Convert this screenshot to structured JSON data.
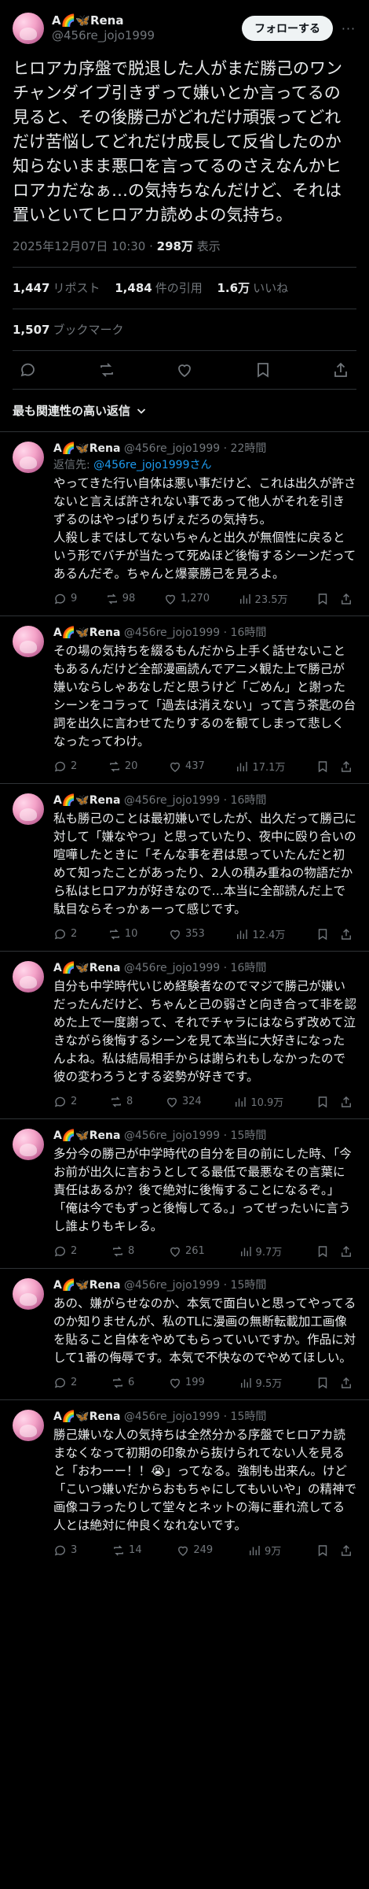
{
  "post": {
    "display_name": "A🌈🦋Rena",
    "handle": "@456re_jojo1999",
    "follow_label": "フォローする",
    "more_label": "···",
    "text": "ヒロアカ序盤で脱退した人がまだ勝己のワンチャンダイブ引きずって嫌いとか言ってるの見ると、その後勝己がどれだけ頑張ってどれだけ苦悩してどれだけ成長して反省したのか知らないまま悪口を言ってるのさえなんかヒロアカだなぁ…の気持ちなんだけど、それは置いといてヒロアカ読めよの気持ち。",
    "timestamp": "2025年12月07日 10:30 · ",
    "views_count": "298万",
    "views_label": " 表示",
    "stats": {
      "reposts_count": "1,447",
      "reposts_label": "リポスト",
      "quotes_count": "1,484",
      "quotes_label": "件の引用",
      "likes_count": "1.6万",
      "likes_label": "いいね",
      "bookmarks_count": "1,507",
      "bookmarks_label": "ブックマーク"
    }
  },
  "sort_label": "最も関連性の高い返信",
  "replies": [
    {
      "name": "A🌈🦋Rena",
      "handle": "@456re_jojo1999",
      "time": "22時間",
      "reply_to_label": "返信先:",
      "reply_to_mention": "@456re_jojo1999さん",
      "text": "やってきた行い自体は悪い事だけど、これは出久が許さないと言えば許されない事であって他人がそれを引きずるのはやっぱりちげぇだろの気持ち。\n人殺しまではしてないちゃんと出久が無個性に戻るという形でバチが当たって死ぬほど後悔するシーンだってあるんだぞ。ちゃんと爆豪勝己を見ろよ。",
      "replies": "9",
      "reposts": "98",
      "likes": "1,270",
      "views": "23.5万"
    },
    {
      "name": "A🌈🦋Rena",
      "handle": "@456re_jojo1999",
      "time": "16時間",
      "text": "その場の気持ちを綴るもんだから上手く話せないこともあるんだけど全部漫画読んでアニメ観た上で勝己が嫌いならしゃあなしだと思うけど「ごめん」と謝ったシーンをコラって「過去は消えない」って言う茶匙の台詞を出久に言わせてたりするのを観てしまって悲しくなったってわけ。",
      "replies": "2",
      "reposts": "20",
      "likes": "437",
      "views": "17.1万"
    },
    {
      "name": "A🌈🦋Rena",
      "handle": "@456re_jojo1999",
      "time": "16時間",
      "text": "私も勝己のことは最初嫌いでしたが、出久だって勝己に対して「嫌なやつ」と思っていたり、夜中に殴り合いの喧嘩したときに「そんな事を君は思っていたんだと初めて知ったことがあったり、2人の積み重ねの物語だから私はヒロアカが好きなので…本当に全部読んだ上で駄目ならそっかぁーって感じです。",
      "replies": "2",
      "reposts": "10",
      "likes": "353",
      "views": "12.4万"
    },
    {
      "name": "A🌈🦋Rena",
      "handle": "@456re_jojo1999",
      "time": "16時間",
      "text": "自分も中学時代いじめ経験者なのでマジで勝己が嫌いだったんだけど、ちゃんと己の弱さと向き合って非を認めた上で一度謝って、それでチャラにはならず改めて泣きながら後悔するシーンを見て本当に大好きになったんよね。私は結局相手からは謝られもしなかったので彼の変わろうとする姿勢が好きです。",
      "replies": "2",
      "reposts": "8",
      "likes": "324",
      "views": "10.9万"
    },
    {
      "name": "A🌈🦋Rena",
      "handle": "@456re_jojo1999",
      "time": "15時間",
      "text": "多分今の勝己が中学時代の自分を目の前にした時、「今お前が出久に言おうとしてる最低で最悪なその言葉に責任はあるか？後で絶対に後悔することになるぞ。」\n「俺は今でもずっと後悔してる。」ってぜったいに言うし誰よりもキレる。",
      "replies": "2",
      "reposts": "8",
      "likes": "261",
      "views": "9.7万"
    },
    {
      "name": "A🌈🦋Rena",
      "handle": "@456re_jojo1999",
      "time": "15時間",
      "text": "あの、嫌がらせなのか、本気で面白いと思ってやってるのか知りませんが、私のTLに漫画の無断転載加工画像を貼ること自体をやめてもらっていいですか。作品に対して1番の侮辱です。本気で不快なのでやめてほしい。",
      "replies": "2",
      "reposts": "6",
      "likes": "199",
      "views": "9.5万"
    },
    {
      "name": "A🌈🦋Rena",
      "handle": "@456re_jojo1999",
      "time": "15時間",
      "text": "勝己嫌いな人の気持ちは全然分かる序盤でヒロアカ読まなくなって初期の印象から抜けられてない人を見ると「おわーー！！😭」ってなる。強制も出来ん。けど「こいつ嫌いだからおもちゃにしてもいいや」の精神で画像コラったりして堂々とネットの海に垂れ流してる人とは絶対に仲良くなれないです。",
      "replies": "3",
      "reposts": "14",
      "likes": "249",
      "views": "9万"
    }
  ],
  "icons": [
    "reply-icon",
    "repost-icon",
    "like-icon",
    "views-icon",
    "bookmark-icon",
    "share-icon",
    "chevron-down-icon"
  ]
}
